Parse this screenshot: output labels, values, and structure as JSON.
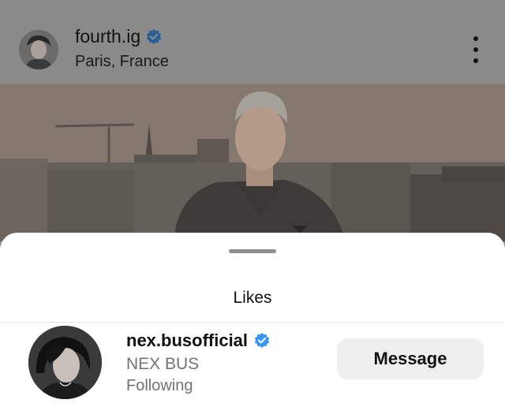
{
  "post": {
    "username": "fourth.ig",
    "location": "Paris, France",
    "verified": true,
    "more_icon": "more-vertical-icon"
  },
  "sheet": {
    "title": "Likes"
  },
  "likes": [
    {
      "username": "nex.busofficial",
      "full_name": "NEX BUS",
      "status": "Following",
      "verified": true,
      "button_label": "Message"
    }
  ],
  "colors": {
    "verified_badge": "#3797f0",
    "overlay_dim": "#8a8a8a",
    "sheet_bg": "#ffffff",
    "secondary_text": "#737373",
    "button_bg": "#efefef"
  }
}
